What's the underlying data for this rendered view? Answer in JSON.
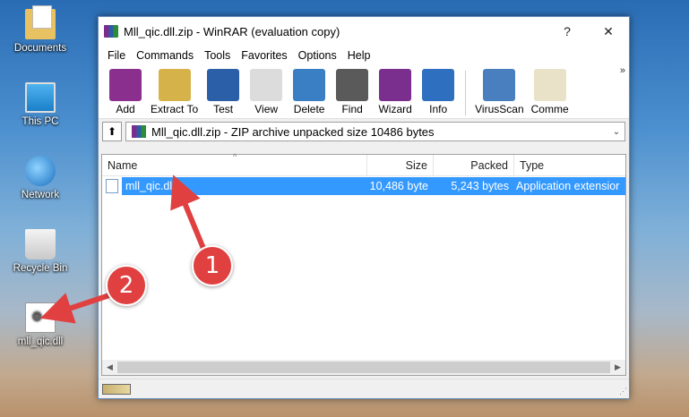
{
  "desktop": {
    "icons": [
      {
        "label": "Documents",
        "icon": "folder-icon"
      },
      {
        "label": "This PC",
        "icon": "computer-icon"
      },
      {
        "label": "Network",
        "icon": "network-icon"
      },
      {
        "label": "Recycle Bin",
        "icon": "recycle-bin-icon"
      },
      {
        "label": "mll_qic.dll",
        "icon": "dll-file-icon"
      }
    ]
  },
  "window": {
    "title": "Mll_qic.dll.zip - WinRAR (evaluation copy)",
    "help_glyph": "?",
    "close_glyph": "✕",
    "menu": [
      "File",
      "Commands",
      "Tools",
      "Favorites",
      "Options",
      "Help"
    ],
    "toolbar": [
      {
        "label": "Add",
        "color": "#8b2f8f"
      },
      {
        "label": "Extract To",
        "color": "#d6b34a"
      },
      {
        "label": "Test",
        "color": "#2b5fa8"
      },
      {
        "label": "View",
        "color": "#dcdcdc"
      },
      {
        "label": "Delete",
        "color": "#3a7fc4"
      },
      {
        "label": "Find",
        "color": "#5a5a5a"
      },
      {
        "label": "Wizard",
        "color": "#7a2f8f"
      },
      {
        "label": "Info",
        "color": "#2f6fbf"
      },
      {
        "label": "VirusScan",
        "color": "#4a7fbf"
      },
      {
        "label": "Comme",
        "color": "#e9e2c8"
      }
    ],
    "toolbar_overflow": "»",
    "address": {
      "up_glyph": "⬆",
      "text": "Mll_qic.dll.zip - ZIP archive unpacked size 10486 bytes",
      "dropdown_glyph": "⌄"
    },
    "columns": [
      "Name",
      "Size",
      "Packed",
      "Type"
    ],
    "sort_glyph": "^",
    "rows": [
      {
        "name": "mll_qic.dll",
        "size": "10,486 byte",
        "packed": "5,243 bytes",
        "type": "Application extensior"
      }
    ],
    "scroll_left": "◀",
    "scroll_right": "▶"
  },
  "annotations": [
    {
      "number": "1",
      "color": "#e04040"
    },
    {
      "number": "2",
      "color": "#e04040"
    }
  ]
}
